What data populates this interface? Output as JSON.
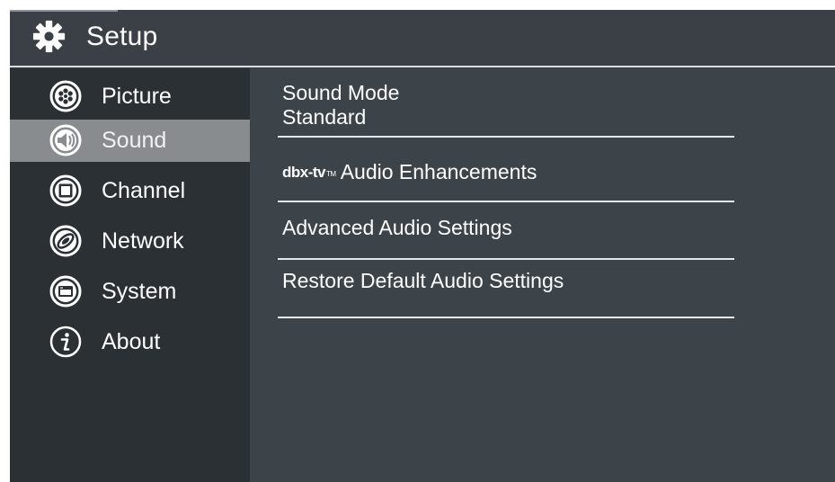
{
  "header": {
    "title": "Setup"
  },
  "sidebar": {
    "items": [
      {
        "label": "Picture",
        "icon": "picture-icon"
      },
      {
        "label": "Sound",
        "icon": "speaker-icon",
        "selected": true
      },
      {
        "label": "Channel",
        "icon": "channel-icon"
      },
      {
        "label": "Network",
        "icon": "network-icon"
      },
      {
        "label": "System",
        "icon": "system-icon"
      },
      {
        "label": "About",
        "icon": "info-icon"
      }
    ]
  },
  "main": {
    "options": [
      {
        "label": "Sound Mode",
        "value": "Standard"
      },
      {
        "logo": "dbx-tv",
        "logo_tm": "TM",
        "label": "Audio Enhancements"
      },
      {
        "label": "Advanced Audio Settings"
      },
      {
        "label": "Restore Default Audio Settings"
      }
    ]
  },
  "colors": {
    "background": "#3a4045",
    "sidebar": "#2a3034",
    "selected": "#888c8f",
    "text": "#ffffff"
  }
}
